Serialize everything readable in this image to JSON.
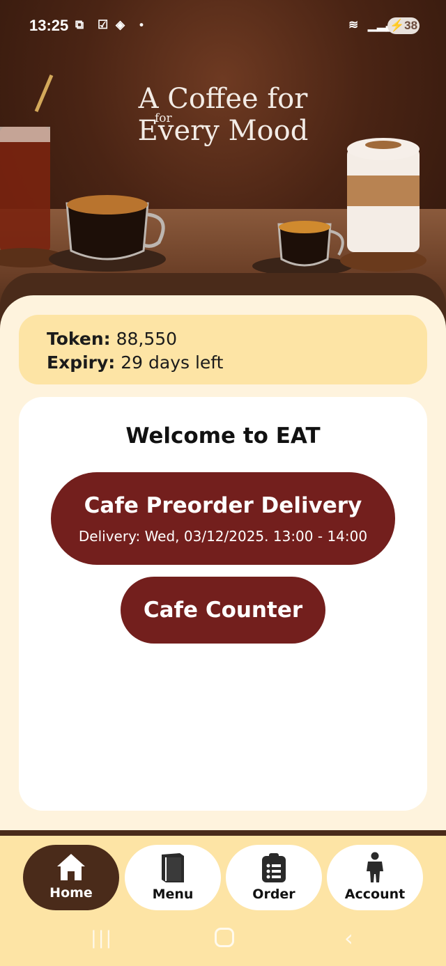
{
  "status_bar": {
    "time": "13:25",
    "battery": "38"
  },
  "hero": {
    "line1": "A Coffee for",
    "small": "for",
    "line2": "Every Mood"
  },
  "token": {
    "token_label": "Token:",
    "token_value": "88,550",
    "expiry_label": "Expiry:",
    "expiry_value": "29 days left"
  },
  "welcome": {
    "title": "Welcome to EAT",
    "preorder_label": "Cafe Preorder Delivery",
    "preorder_sub": "Delivery: Wed, 03/12/2025. 13:00 - 14:00",
    "counter_label": "Cafe Counter"
  },
  "nav": {
    "home": "Home",
    "menu": "Menu",
    "order": "Order",
    "account": "Account"
  },
  "colors": {
    "brand_dark": "#4a2b1a",
    "button": "#731f1d",
    "cream": "#fef3dd",
    "token_bg": "#fde4a5"
  }
}
